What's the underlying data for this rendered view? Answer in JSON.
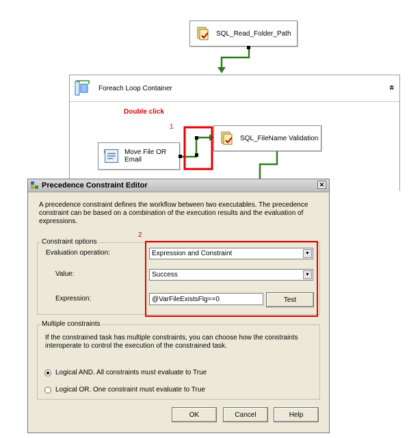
{
  "designer": {
    "task_sql_read": "SQL_Read_Folder_Path",
    "container_title": "Foreach Loop Container",
    "double_click_note": "Double click",
    "step1": "1",
    "task_sql_filename": "SQL_FileName Validation",
    "task_move_file_line1": "Move File OR",
    "task_move_file_line2": "Email",
    "collapse_glyph": "«"
  },
  "dialog": {
    "title": "Precedence Constraint Editor",
    "close_glyph": "✕",
    "description": "A precedence constraint defines the workflow between two executables. The precedence constraint can be based on a combination of the execution results and the evaluation of expressions.",
    "constraint_options_legend": "Constraint options",
    "step2": "2",
    "evaluation_label": "Evaluation operation:",
    "evaluation_value": "Expression and Constraint",
    "value_label": "Value:",
    "value_value": "Success",
    "expression_label": "Expression:",
    "expression_value": "@VarFileExistsFlg==0",
    "test_label": "Test",
    "multiple_legend": "Multiple constraints",
    "multiple_desc": "If the constrained task has multiple constraints, you can choose how the constraints interoperate to control the execution of the constrained task.",
    "logical_and": "Logical AND. All constraints must evaluate to True",
    "logical_or": "Logical OR. One constraint must evaluate to True",
    "ok": "OK",
    "cancel": "Cancel",
    "help": "Help",
    "dropdown_glyph": "▼"
  },
  "colors": {
    "highlight_red": "#e00000",
    "constraint_green": "#2e7d1a"
  }
}
